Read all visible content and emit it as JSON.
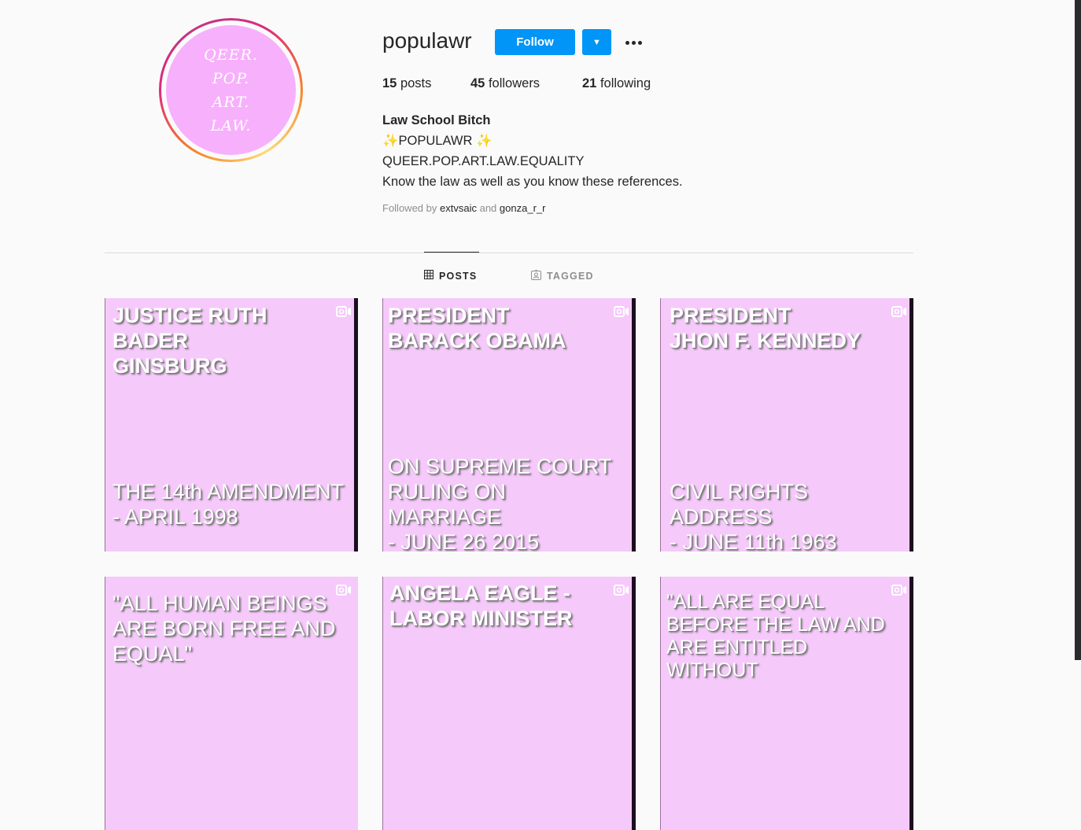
{
  "profile": {
    "avatar_lines": [
      "QEER.",
      "POP.",
      "ART.",
      "LAW."
    ],
    "username": "populawr",
    "follow_label": "Follow",
    "dropdown_glyph": "▼",
    "stats": {
      "posts_count": "15",
      "posts_label": "posts",
      "followers_count": "45",
      "followers_label": "followers",
      "following_count": "21",
      "following_label": "following"
    },
    "bio": {
      "name": "Law School Bitch",
      "line1": "✨POPULAWR ✨",
      "line2": "QUEER.POP.ART.LAW.EQUALITY",
      "line3": "Know the law as well as you know these references."
    },
    "followed_by": {
      "prefix": "Followed by",
      "user1": "extvsaic",
      "joiner": "and",
      "user2": "gonza_r_r"
    }
  },
  "tabs": [
    {
      "label": "POSTS",
      "icon": "grid-icon",
      "active": true
    },
    {
      "label": "TAGGED",
      "icon": "tagged-icon",
      "active": false
    }
  ],
  "posts": [
    {
      "title": "JUSTICE RUTH BADER\nGINSBURG",
      "subtitle": "THE 14th AMENDMENT\n- APRIL 1998"
    },
    {
      "title": "PRESIDENT\nBARACK OBAMA",
      "subtitle": "ON SUPREME COURT\nRULING ON MARRIAGE\n- JUNE 26 2015"
    },
    {
      "title": "PRESIDENT\nJHON F. KENNEDY",
      "subtitle": "CIVIL RIGHTS ADDRESS\n- JUNE 11th 1963"
    },
    {
      "title": "\"ALL HUMAN BEINGS\nARE BORN FREE AND\nEQUAL\""
    },
    {
      "title": "ANGELA EAGLE -\nLABOR MINISTER"
    },
    {
      "title": "\"ALL ARE EQUAL\nBEFORE THE LAW AND\nARE ENTITLED WITHOUT"
    }
  ],
  "colors": {
    "accent": "#0095f6",
    "post_background": "#f6c9fb",
    "avatar_background": "#f7b0fb"
  }
}
